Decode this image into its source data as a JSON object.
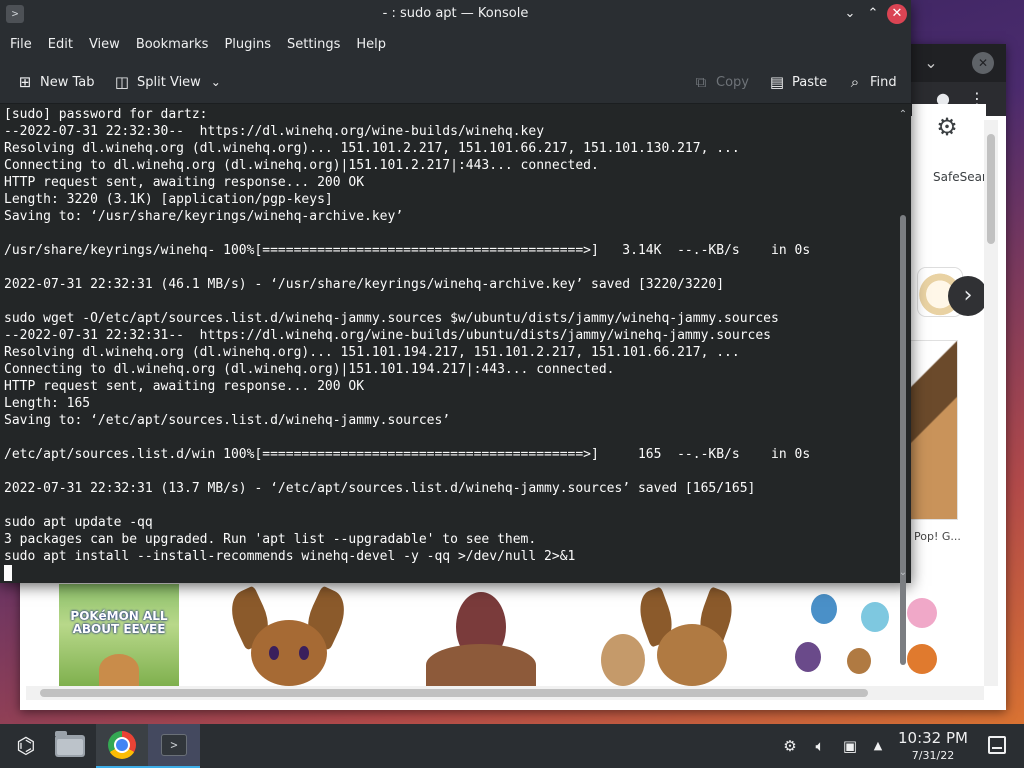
{
  "konsole": {
    "title": "- : sudo apt — Konsole",
    "app_icon": "terminal-icon",
    "window_buttons": [
      "minimize-icon",
      "maximize-icon",
      "close-icon"
    ],
    "menu": [
      "File",
      "Edit",
      "View",
      "Bookmarks",
      "Plugins",
      "Settings",
      "Help"
    ],
    "toolbar": {
      "new_tab": "New Tab",
      "split_view": "Split View",
      "copy": "Copy",
      "paste": "Paste",
      "find": "Find"
    },
    "terminal_lines": [
      "[sudo] password for dartz:",
      "--2022-07-31 22:32:30--  https://dl.winehq.org/wine-builds/winehq.key",
      "Resolving dl.winehq.org (dl.winehq.org)... 151.101.2.217, 151.101.66.217, 151.101.130.217, ...",
      "Connecting to dl.winehq.org (dl.winehq.org)|151.101.2.217|:443... connected.",
      "HTTP request sent, awaiting response... 200 OK",
      "Length: 3220 (3.1K) [application/pgp-keys]",
      "Saving to: ‘/usr/share/keyrings/winehq-archive.key’",
      "",
      "/usr/share/keyrings/winehq- 100%[=========================================>]   3.14K  --.-KB/s    in 0s",
      "",
      "2022-07-31 22:32:31 (46.1 MB/s) - ‘/usr/share/keyrings/winehq-archive.key’ saved [3220/3220]",
      "",
      "sudo wget -O/etc/apt/sources.list.d/winehq-jammy.sources $w/ubuntu/dists/jammy/winehq-jammy.sources",
      "--2022-07-31 22:32:31--  https://dl.winehq.org/wine-builds/ubuntu/dists/jammy/winehq-jammy.sources",
      "Resolving dl.winehq.org (dl.winehq.org)... 151.101.194.217, 151.101.2.217, 151.101.66.217, ...",
      "Connecting to dl.winehq.org (dl.winehq.org)|151.101.194.217|:443... connected.",
      "HTTP request sent, awaiting response... 200 OK",
      "Length: 165",
      "Saving to: ‘/etc/apt/sources.list.d/winehq-jammy.sources’",
      "",
      "/etc/apt/sources.list.d/win 100%[=========================================>]     165  --.-KB/s    in 0s",
      "",
      "2022-07-31 22:32:31 (13.7 MB/s) - ‘/etc/apt/sources.list.d/winehq-jammy.sources’ saved [165/165]",
      "",
      "sudo apt update -qq",
      "3 packages can be upgraded. Run 'apt list --upgradable' to see them.",
      "sudo apt install --install-recommends winehq-devel -y -qq >/dev/null 2>&1"
    ]
  },
  "browser": {
    "safesearch_label": "SafeSear",
    "image_caption": "Pop! G...",
    "book_title": "POKéMON ALL ABOUT EEVEE",
    "icons": [
      "chevron-down-icon",
      "close-icon",
      "account-icon",
      "more-vert-icon",
      "gear-icon",
      "chevron-right-icon"
    ]
  },
  "taskbar": {
    "apps": [
      "application-launcher-icon",
      "file-manager-icon",
      "chrome-icon",
      "konsole-icon"
    ],
    "tray": [
      "steam-icon",
      "volume-icon",
      "network-icon",
      "tray-expand-icon"
    ],
    "time": "10:32 PM",
    "date": "7/31/22"
  }
}
